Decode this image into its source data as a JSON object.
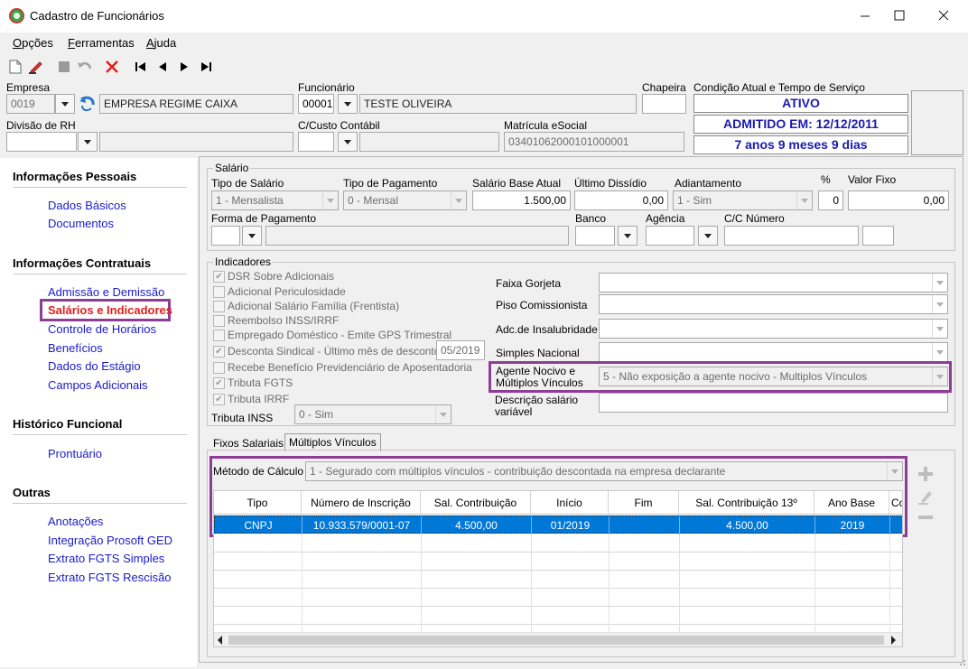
{
  "window": {
    "title": "Cadastro de Funcionários"
  },
  "menu": [
    {
      "label": "Opções",
      "key": "O",
      "rest": "pções"
    },
    {
      "label": "Ferramentas",
      "key": "F",
      "rest": "erramentas"
    },
    {
      "label": "Ajuda",
      "key": "A",
      "rest": "juda"
    }
  ],
  "header": {
    "empresa_label": "Empresa",
    "empresa_code": "0019",
    "empresa_name": "EMPRESA REGIME CAIXA",
    "funcionario_label": "Funcionário",
    "funcionario_code": "00001",
    "funcionario_name": "TESTE OLIVEIRA",
    "chapeira_label": "Chapeira",
    "chapeira_value": "",
    "condicao_label": "Condição Atual e Tempo de Serviço",
    "status": "ATIVO",
    "admitido": "ADMITIDO EM: 12/12/2011",
    "tempo": "7 anos 9 meses 9 dias",
    "divisao_label": "Divisão de RH",
    "ccusto_label": "C/Custo Contábil",
    "matricula_label": "Matrícula eSocial",
    "matricula_value": "03401062000101000001"
  },
  "nav": {
    "sections": [
      {
        "title": "Informações Pessoais",
        "items": [
          "Dados Básicos",
          "Documentos"
        ]
      },
      {
        "title": "Informações Contratuais",
        "items": [
          "Admissão e Demissão",
          "Salários e Indicadores",
          "Controle de Horários",
          "Benefícios",
          "Dados do Estágio",
          "Campos Adicionais"
        ]
      },
      {
        "title": "Histórico Funcional",
        "items": [
          "Prontuário"
        ]
      },
      {
        "title": "Outras",
        "items": [
          "Anotações",
          "Integração Prosoft GED",
          "Extrato FGTS Simples",
          "Extrato FGTS Rescisão"
        ]
      }
    ],
    "active": "Salários e Indicadores"
  },
  "salario": {
    "group_title": "Salário",
    "tipo_salario_label": "Tipo de Salário",
    "tipo_salario": "1 - Mensalista",
    "tipo_pagamento_label": "Tipo de Pagamento",
    "tipo_pagamento": "0 - Mensal",
    "base_label": "Salário Base Atual",
    "base_value": "1.500,00",
    "dissidio_label": "Último Dissídio",
    "dissidio_value": "0,00",
    "adiantamento_label": "Adiantamento",
    "adiantamento_value": "1 - Sim",
    "pct_label": "%",
    "pct_value": "0",
    "valor_fixo_label": "Valor Fixo",
    "valor_fixo_value": "0,00",
    "forma_label": "Forma de Pagamento",
    "banco_label": "Banco",
    "agencia_label": "Agência",
    "cc_label": "C/C Número"
  },
  "indicadores": {
    "group_title": "Indicadores",
    "checks": [
      {
        "label": "DSR Sobre Adicionais",
        "checked": true
      },
      {
        "label": "Adicional Periculosidade",
        "checked": false
      },
      {
        "label": "Adicional Salário Família (Frentista)",
        "checked": false
      },
      {
        "label": "Reembolso INSS/IRRF",
        "checked": false
      },
      {
        "label": "Empregado Doméstico - Emite GPS Trimestral",
        "checked": false
      },
      {
        "label": "Desconta Sindical - Último mês de desconto",
        "checked": true
      },
      {
        "label": "Recebe Benefício Previdenciário de Aposentadoria",
        "checked": false
      },
      {
        "label": "Tributa FGTS",
        "checked": true
      },
      {
        "label": "Tributa IRRF",
        "checked": true
      }
    ],
    "sindical_mes": "05/2019",
    "tributa_inss_label": "Tributa INSS",
    "tributa_inss_value": "0 - Sim",
    "faixa_gorjeta_label": "Faixa Gorjeta",
    "piso_label": "Piso Comissionista",
    "insalubridade_label": "Adc.de Insalubridade",
    "simples_label": "Simples Nacional",
    "agente_label_1": "Agente Nocivo e",
    "agente_label_2": "Múltiplos Vínculos",
    "agente_value": "5 - Não exposição a agente nocivo - Multiplos Vínculos",
    "desc_label_1": "Descrição salário",
    "desc_label_2": "variável"
  },
  "tabs": [
    "Fixos Salariais",
    "Múltiplos Vínculos"
  ],
  "active_tab": "Múltiplos Vínculos",
  "vinculos": {
    "metodo_label": "Método de Cálculo",
    "metodo_value": "1 - Segurado com múltiplos vínculos - contribuição descontada na empresa declarante",
    "columns": [
      "Tipo",
      "Número de Inscrição",
      "Sal. Contribuição",
      "Início",
      "Fim",
      "Sal. Contribuição 13º",
      "Ano Base",
      "Co"
    ],
    "rows": [
      [
        "CNPJ",
        "10.933.579/0001-07",
        "4.500,00",
        "01/2019",
        "",
        "4.500,00",
        "2019",
        ""
      ]
    ]
  },
  "colors": {
    "accent_purple": "#8e3d96",
    "selection_blue": "#0078d7",
    "link_blue": "#1a1acb",
    "active_red": "#e0201c",
    "status_blue": "#1a1ab0"
  }
}
